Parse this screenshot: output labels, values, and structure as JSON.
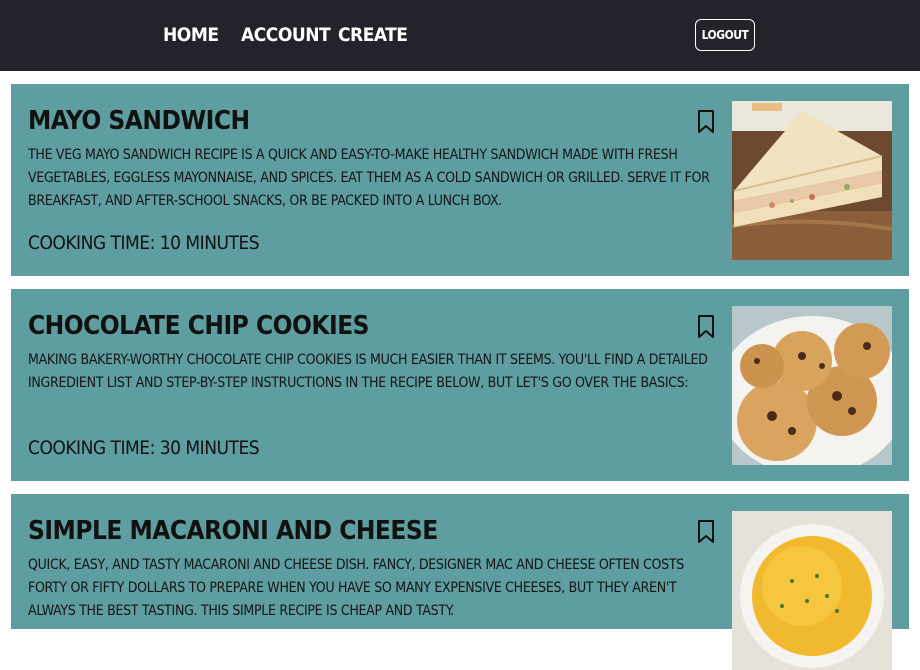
{
  "nav": {
    "home": "Home",
    "account": "Account",
    "create": "Create",
    "logout": "Logout"
  },
  "recipes": [
    {
      "title": "Mayo Sandwich",
      "description": "The Veg Mayo Sandwich recipe is a quick and easy-to-make healthy sandwich made with fresh vegetables, eggless mayonnaise, and spices. Eat them as a cold sandwich or grilled. Serve it for breakfast, and after-school snacks, or be packed into a lunch box.",
      "cooking_time": "Cooking Time: 10 minutes"
    },
    {
      "title": "Chocolate Chip Cookies",
      "description": "Making bakery-worthy chocolate chip cookies is much easier than it seems. You'll find a detailed ingredient list and step-by-step instructions in the recipe below, but let's go over the basics:",
      "cooking_time": "Cooking Time: 30 minutes"
    },
    {
      "title": "Simple Macaroni and Cheese",
      "description": "Quick, easy, and tasty macaroni and cheese dish. Fancy, designer mac and cheese often costs forty or fifty dollars to prepare when you have so many expensive cheeses, but they aren't always the best tasting. This simple recipe is cheap and tasty."
    }
  ],
  "colors": {
    "topbar": "#24232b",
    "card": "#5f9ea0"
  }
}
